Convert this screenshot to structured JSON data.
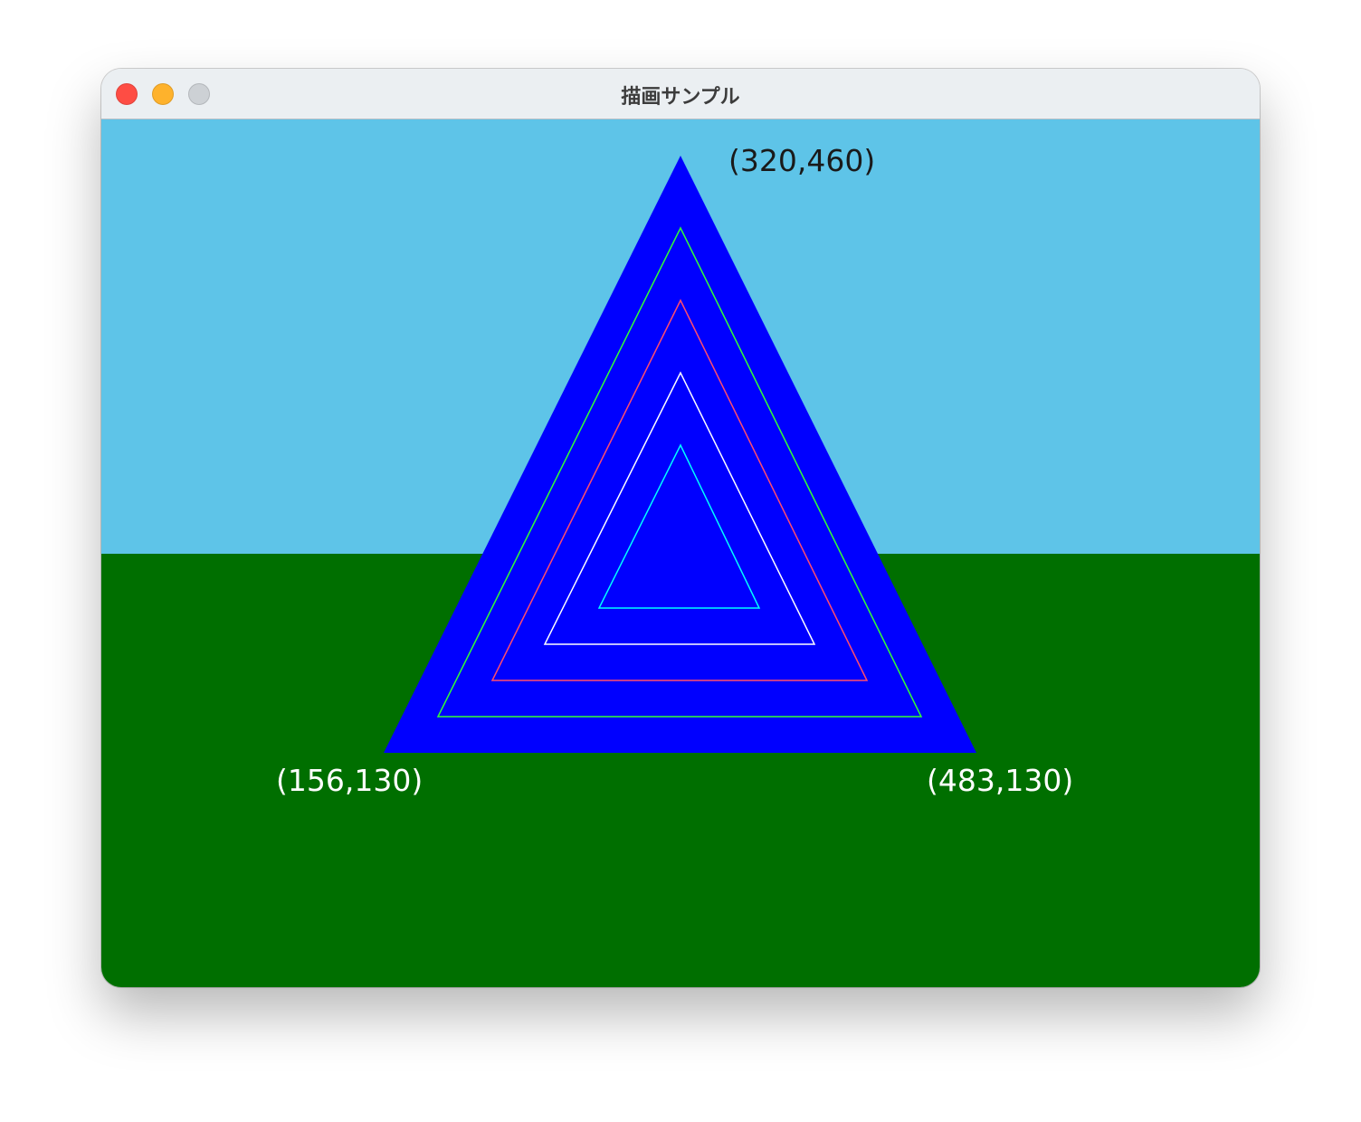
{
  "window": {
    "title": "描画サンプル",
    "traffic_lights": {
      "close_color": "#fe4d44",
      "minimize_color": "#feb22c",
      "zoom_color": "#cdd1d5"
    }
  },
  "canvas": {
    "sky_color": "#5ec4e8",
    "ground_color": "#006f00",
    "triangle_fill": "#0000ff",
    "outline_colors": [
      "#33ff33",
      "#ff4d6d",
      "#ffffff",
      "#00ffff"
    ],
    "labels": {
      "top": "(320,460)",
      "left": "(156,130)",
      "right": "(483,130)"
    },
    "label_colors": {
      "top": "#1a1a1a",
      "left": "#ffffff",
      "right": "#ffffff"
    }
  }
}
